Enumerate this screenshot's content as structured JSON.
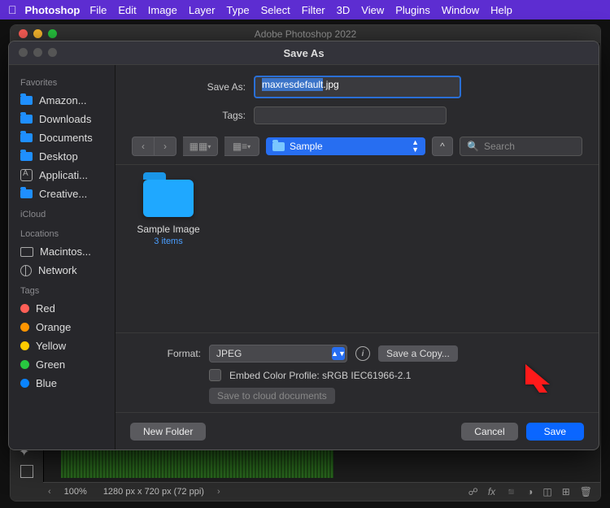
{
  "menubar": {
    "app": "Photoshop",
    "items": [
      "File",
      "Edit",
      "Image",
      "Layer",
      "Type",
      "Select",
      "Filter",
      "3D",
      "View",
      "Plugins",
      "Window",
      "Help"
    ]
  },
  "docwin": {
    "title": "Adobe Photoshop 2022"
  },
  "status": {
    "zoom": "100%",
    "dims": "1280 px x 720 px (72 ppi)"
  },
  "dialog": {
    "title": "Save As",
    "save_as_label": "Save As:",
    "tags_label": "Tags:",
    "filename": "maxresdefault",
    "ext": ".jpg",
    "path_folder": "Sample",
    "search_placeholder": "Search",
    "folder_name": "Sample Image",
    "folder_meta": "3 items",
    "format_label": "Format:",
    "format_value": "JPEG",
    "save_copy": "Save a Copy...",
    "embed_label": "Embed Color Profile:  sRGB IEC61966-2.1",
    "cloud_btn": "Save to cloud documents",
    "new_folder": "New Folder",
    "cancel": "Cancel",
    "save": "Save"
  },
  "sidebar": {
    "favorites_hdr": "Favorites",
    "favorites": [
      "Amazon...",
      "Downloads",
      "Documents",
      "Desktop",
      "Applicati...",
      "Creative..."
    ],
    "icloud_hdr": "iCloud",
    "locations_hdr": "Locations",
    "locations": [
      "Macintos...",
      "Network"
    ],
    "tags_hdr": "Tags",
    "tags": [
      "Red",
      "Orange",
      "Yellow",
      "Green",
      "Blue"
    ]
  }
}
